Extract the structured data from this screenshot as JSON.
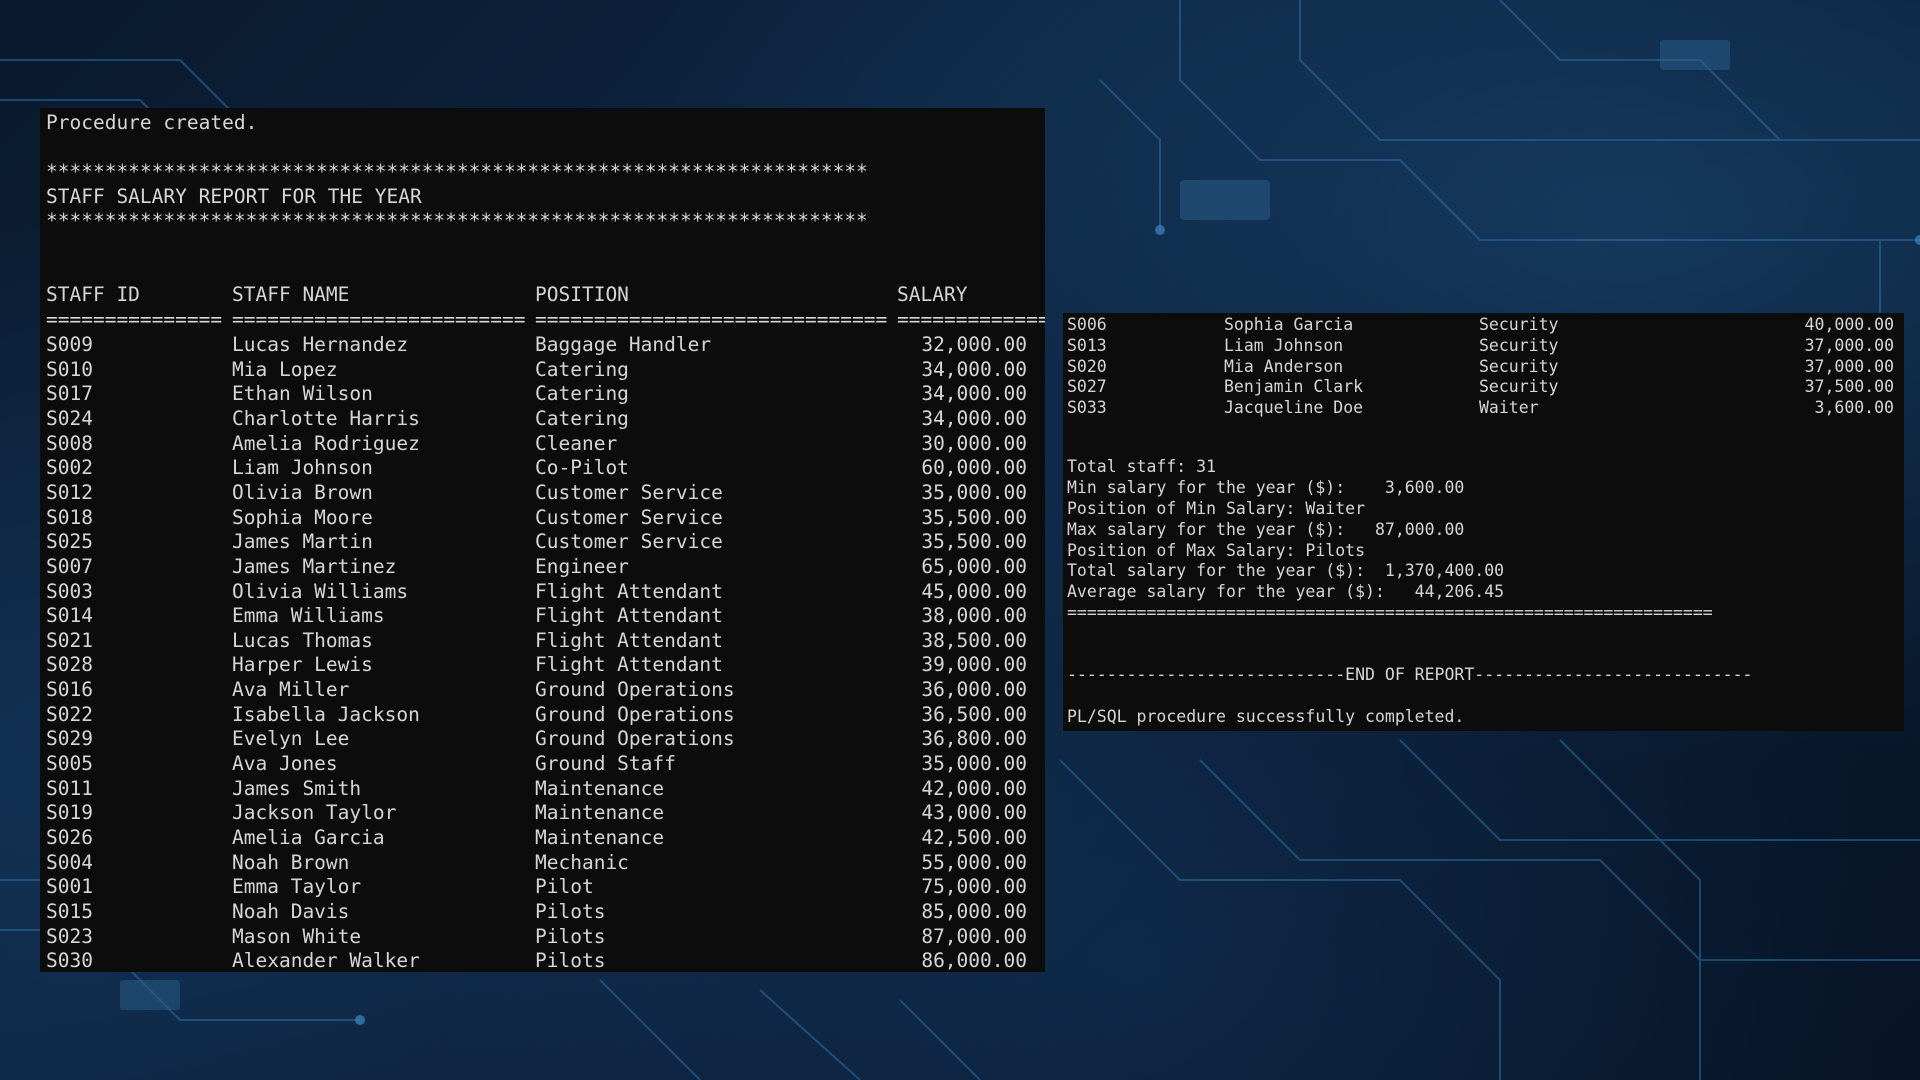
{
  "left_terminal": {
    "procedure_msg": "Procedure created.",
    "banner_top": "**********************************************************************",
    "title": "STAFF SALARY REPORT FOR THE YEAR",
    "banner_bottom": "**********************************************************************",
    "headers": {
      "id": "STAFF ID",
      "name": "STAFF NAME",
      "position": "POSITION",
      "salary": "SALARY"
    },
    "separators": {
      "id": "===============",
      "name": "=========================",
      "position": "==============================",
      "salary": "============="
    },
    "rows": [
      {
        "id": "S009",
        "name": "Lucas Hernandez",
        "position": "Baggage Handler",
        "salary": "32,000.00"
      },
      {
        "id": "S010",
        "name": "Mia Lopez",
        "position": "Catering",
        "salary": "34,000.00"
      },
      {
        "id": "S017",
        "name": "Ethan Wilson",
        "position": "Catering",
        "salary": "34,000.00"
      },
      {
        "id": "S024",
        "name": "Charlotte Harris",
        "position": "Catering",
        "salary": "34,000.00"
      },
      {
        "id": "S008",
        "name": "Amelia Rodriguez",
        "position": "Cleaner",
        "salary": "30,000.00"
      },
      {
        "id": "S002",
        "name": "Liam Johnson",
        "position": "Co-Pilot",
        "salary": "60,000.00"
      },
      {
        "id": "S012",
        "name": "Olivia Brown",
        "position": "Customer Service",
        "salary": "35,000.00"
      },
      {
        "id": "S018",
        "name": "Sophia Moore",
        "position": "Customer Service",
        "salary": "35,500.00"
      },
      {
        "id": "S025",
        "name": "James Martin",
        "position": "Customer Service",
        "salary": "35,500.00"
      },
      {
        "id": "S007",
        "name": "James Martinez",
        "position": "Engineer",
        "salary": "65,000.00"
      },
      {
        "id": "S003",
        "name": "Olivia Williams",
        "position": "Flight Attendant",
        "salary": "45,000.00"
      },
      {
        "id": "S014",
        "name": "Emma Williams",
        "position": "Flight Attendant",
        "salary": "38,000.00"
      },
      {
        "id": "S021",
        "name": "Lucas Thomas",
        "position": "Flight Attendant",
        "salary": "38,500.00"
      },
      {
        "id": "S028",
        "name": "Harper Lewis",
        "position": "Flight Attendant",
        "salary": "39,000.00"
      },
      {
        "id": "S016",
        "name": "Ava Miller",
        "position": "Ground Operations",
        "salary": "36,000.00"
      },
      {
        "id": "S022",
        "name": "Isabella Jackson",
        "position": "Ground Operations",
        "salary": "36,500.00"
      },
      {
        "id": "S029",
        "name": "Evelyn Lee",
        "position": "Ground Operations",
        "salary": "36,800.00"
      },
      {
        "id": "S005",
        "name": "Ava Jones",
        "position": "Ground Staff",
        "salary": "35,000.00"
      },
      {
        "id": "S011",
        "name": "James Smith",
        "position": "Maintenance",
        "salary": "42,000.00"
      },
      {
        "id": "S019",
        "name": "Jackson Taylor",
        "position": "Maintenance",
        "salary": "43,000.00"
      },
      {
        "id": "S026",
        "name": "Amelia Garcia",
        "position": "Maintenance",
        "salary": "42,500.00"
      },
      {
        "id": "S004",
        "name": "Noah Brown",
        "position": "Mechanic",
        "salary": "55,000.00"
      },
      {
        "id": "S001",
        "name": "Emma Taylor",
        "position": "Pilot",
        "salary": "75,000.00"
      },
      {
        "id": "S015",
        "name": "Noah Davis",
        "position": "Pilots",
        "salary": "85,000.00"
      },
      {
        "id": "S023",
        "name": "Mason White",
        "position": "Pilots",
        "salary": "87,000.00"
      },
      {
        "id": "S030",
        "name": "Alexander Walker",
        "position": "Pilots",
        "salary": "86,000.00"
      }
    ]
  },
  "right_terminal": {
    "rows": [
      {
        "id": "S006",
        "name": "Sophia Garcia",
        "position": "Security",
        "salary": "40,000.00"
      },
      {
        "id": "S013",
        "name": "Liam Johnson",
        "position": "Security",
        "salary": "37,000.00"
      },
      {
        "id": "S020",
        "name": "Mia Anderson",
        "position": "Security",
        "salary": "37,000.00"
      },
      {
        "id": "S027",
        "name": "Benjamin Clark",
        "position": "Security",
        "salary": "37,500.00"
      },
      {
        "id": "S033",
        "name": "Jacqueline Doe",
        "position": "Waiter",
        "salary": "3,600.00"
      }
    ],
    "summary": {
      "total_staff": "Total staff: 31",
      "min_salary": "Min salary for the year ($):    3,600.00",
      "min_position": "Position of Min Salary: Waiter",
      "max_salary": "Max salary for the year ($):   87,000.00",
      "max_position": "Position of Max Salary: Pilots",
      "total_salary": "Total salary for the year ($):  1,370,400.00",
      "average_salary": "Average salary for the year ($):   44,206.45",
      "separator": "=================================================================",
      "end_of_report": "----------------------------END OF REPORT----------------------------",
      "completion_msg": "PL/SQL procedure successfully completed."
    }
  },
  "colors": {
    "terminal_bg": "#0c0c0c",
    "terminal_text": "#d6d6d6",
    "wallpaper": "#0d2440"
  }
}
